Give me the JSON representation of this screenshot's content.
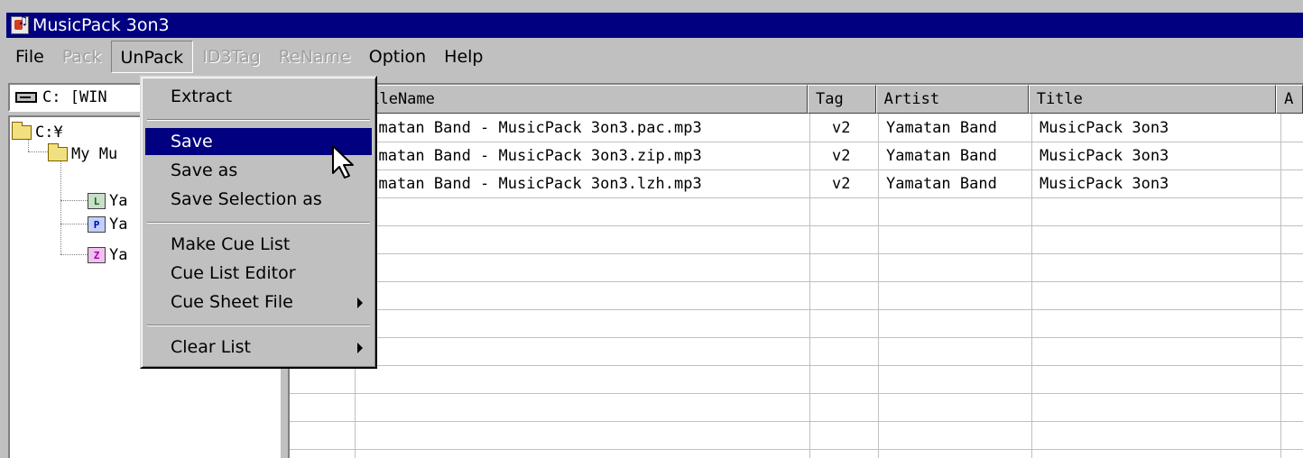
{
  "window": {
    "title": "MusicPack 3on3"
  },
  "menubar": [
    {
      "label": "File",
      "state": "normal"
    },
    {
      "label": "Pack",
      "state": "disabled"
    },
    {
      "label": "UnPack",
      "state": "active"
    },
    {
      "label": "ID3Tag",
      "state": "disabled"
    },
    {
      "label": "ReName",
      "state": "disabled"
    },
    {
      "label": "Option",
      "state": "normal"
    },
    {
      "label": "Help",
      "state": "normal"
    }
  ],
  "drive_combo": {
    "value": "C: [WIN"
  },
  "tree": {
    "root": "C:¥",
    "folder": "My Mu",
    "children": [
      {
        "label": "Ya",
        "icon": "L"
      },
      {
        "label": "Ya",
        "icon": "P"
      },
      {
        "label": "Ya",
        "icon": "Z"
      }
    ]
  },
  "list": {
    "columns": [
      "FileName",
      "Tag",
      "Artist",
      "Title",
      "A"
    ],
    "rows": [
      [
        "Yamatan Band - MusicPack 3on3.pac.mp3",
        "v2",
        "Yamatan Band",
        "MusicPack 3on3",
        ""
      ],
      [
        "Yamatan Band - MusicPack 3on3.zip.mp3",
        "v2",
        "Yamatan Band",
        "MusicPack 3on3",
        ""
      ],
      [
        "Yamatan Band - MusicPack 3on3.lzh.mp3",
        "v2",
        "Yamatan Band",
        "MusicPack 3on3",
        ""
      ]
    ]
  },
  "unpack_menu": {
    "items": {
      "extract": "Extract",
      "save": "Save",
      "save_as": "Save as",
      "save_selection_as": "Save Selection as",
      "make_cue_list": "Make Cue List",
      "cue_list_editor": "Cue List Editor",
      "cue_sheet_file": "Cue Sheet File",
      "clear_list": "Clear List"
    },
    "selected": "Save"
  },
  "colors": {
    "titlebar": "#000080",
    "selection": "#000080",
    "face": "#c0c0c0"
  }
}
